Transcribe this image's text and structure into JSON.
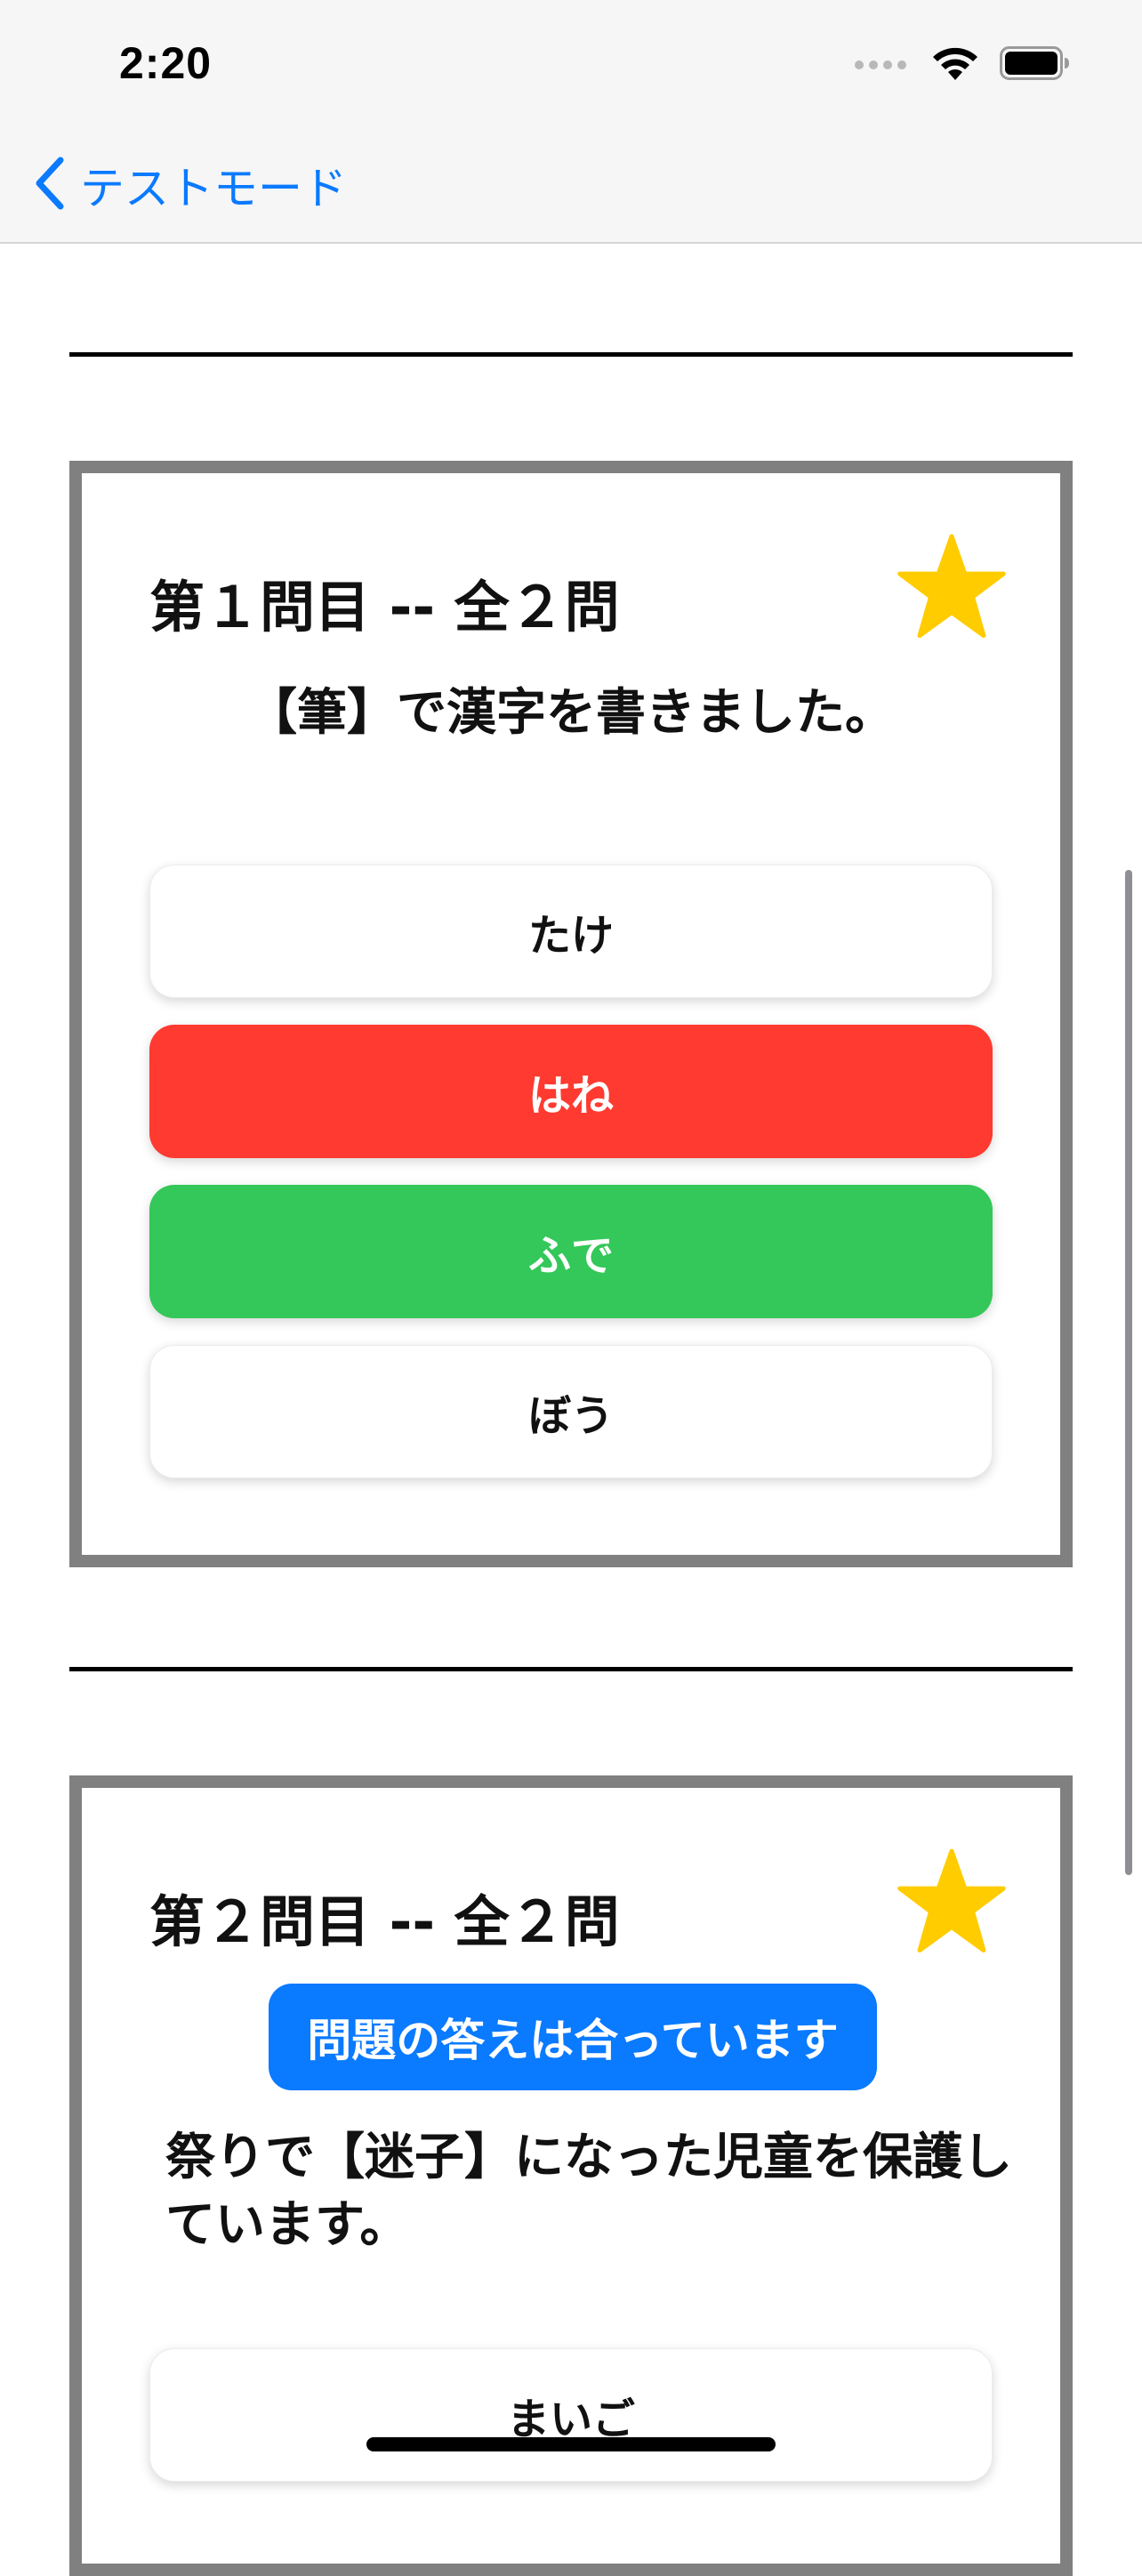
{
  "status_bar": {
    "time": "2:20",
    "icons": [
      "signal-dots-icon",
      "wifi-icon",
      "battery-icon"
    ]
  },
  "nav": {
    "back_label": "テストモード",
    "back_icon": "chevron-left-icon"
  },
  "colors": {
    "accent_blue": "#0a7aff",
    "wrong_red": "#ff3a30",
    "correct_green": "#34c759",
    "star_yellow": "#ffcc00",
    "card_border": "#808080"
  },
  "questions": [
    {
      "header": "第１問目 -- 全２問",
      "star_icon": "star-icon",
      "text": "【筆】で漢字を書きました。",
      "choices": [
        {
          "label": "たけ",
          "state": "default"
        },
        {
          "label": "はね",
          "state": "wrong"
        },
        {
          "label": "ふで",
          "state": "correct"
        },
        {
          "label": "ぼう",
          "state": "default"
        }
      ]
    },
    {
      "header": "第２問目 -- 全２問",
      "star_icon": "star-icon",
      "badge": "問題の答えは合っています",
      "text": "祭りで【迷子】になった児童を保護しています。",
      "choices": [
        {
          "label": "まいご",
          "state": "default"
        }
      ]
    }
  ]
}
